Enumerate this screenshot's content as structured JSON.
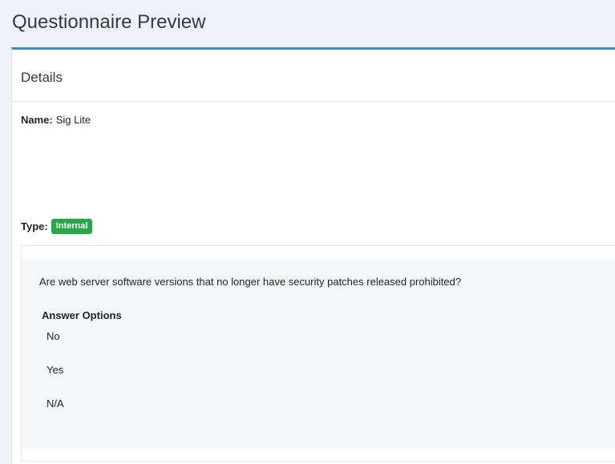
{
  "page": {
    "title": "Questionnaire Preview"
  },
  "details": {
    "title": "Details",
    "name_label": "Name:",
    "name_value": "Sig Lite",
    "type_label": "Type:",
    "type_value": "Internal"
  },
  "question": {
    "text": "Are web server software versions that no longer have security patches released prohibited?",
    "answer_heading": "Answer Options",
    "options": [
      "No",
      "Yes",
      "N/A"
    ]
  },
  "colors": {
    "accent": "#3c8dbc",
    "badge": "#28a745",
    "background": "#eef1f6"
  }
}
